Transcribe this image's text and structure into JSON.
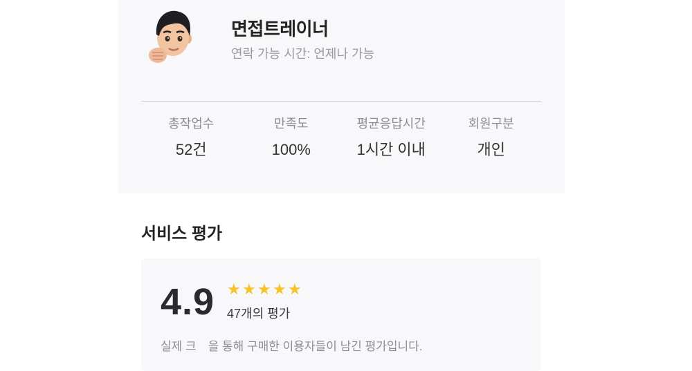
{
  "profile": {
    "name": "면접트레이너",
    "contact_time": "연락 가능 시간: 언제나 가능",
    "stats": [
      {
        "label": "총작업수",
        "value": "52건"
      },
      {
        "label": "만족도",
        "value": "100%"
      },
      {
        "label": "평균응답시간",
        "value": "1시간 이내"
      },
      {
        "label": "회원구분",
        "value": "개인"
      }
    ]
  },
  "reviews": {
    "section_title": "서비스 평가",
    "score": "4.9",
    "stars": 5,
    "count_text": "47개의 평가",
    "note": "실제 크　을 통해 구매한 이용자들이 남긴 평가입니다.",
    "star_color": "#f5c227"
  }
}
